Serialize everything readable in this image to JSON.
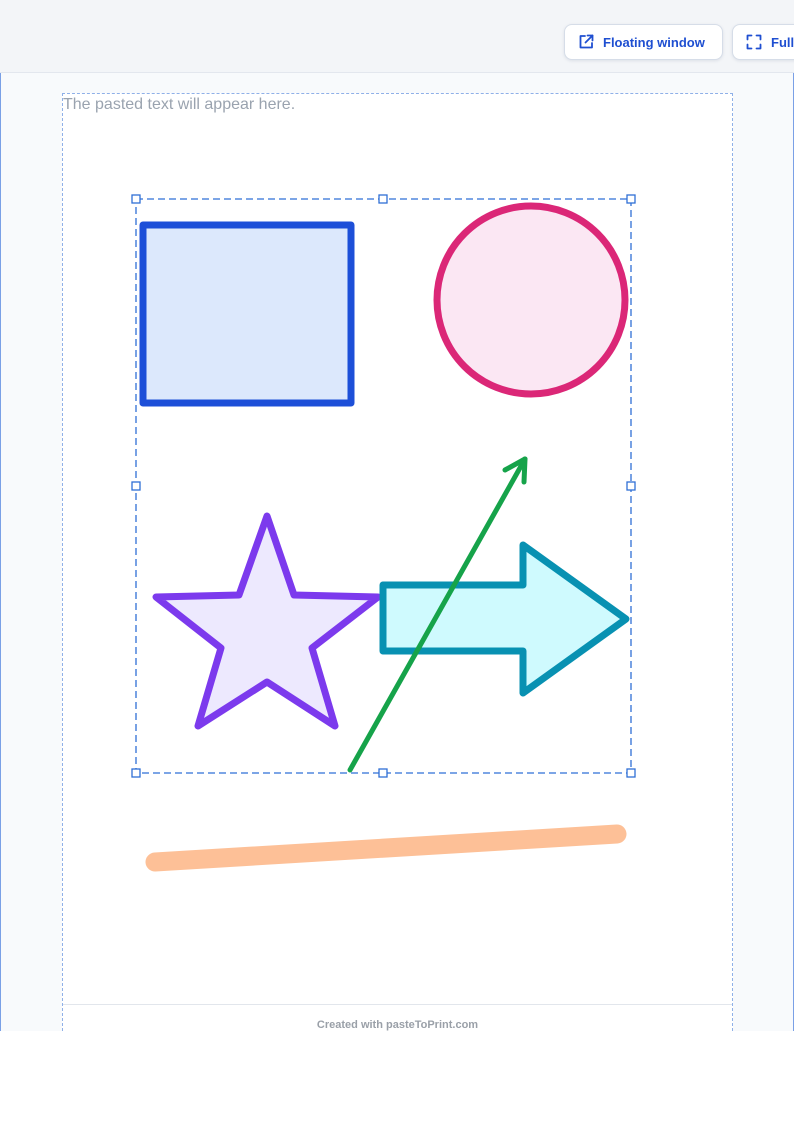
{
  "toolbar": {
    "floating_label": "Floating window",
    "fullscreen_label": "Full",
    "accent_color": "#1f4fd1"
  },
  "document": {
    "placeholder": "The pasted text will appear here.",
    "footer": "Created with pasteToPrint.com"
  },
  "drawing": {
    "selection_color": "#2f6fd6",
    "shapes": [
      {
        "kind": "rectangle",
        "stroke": "#1d4fd8",
        "fill": "#dce8fc"
      },
      {
        "kind": "circle",
        "stroke": "#db2777",
        "fill": "#fbe7f3"
      },
      {
        "kind": "star",
        "stroke": "#7c3aed",
        "fill": "#ede9fe"
      },
      {
        "kind": "block-arrow",
        "stroke": "#0891b2",
        "fill": "#cffafe"
      },
      {
        "kind": "line-arrow",
        "stroke": "#16a34a"
      },
      {
        "kind": "highlighter-stroke",
        "stroke": "#fdba8c"
      }
    ]
  }
}
